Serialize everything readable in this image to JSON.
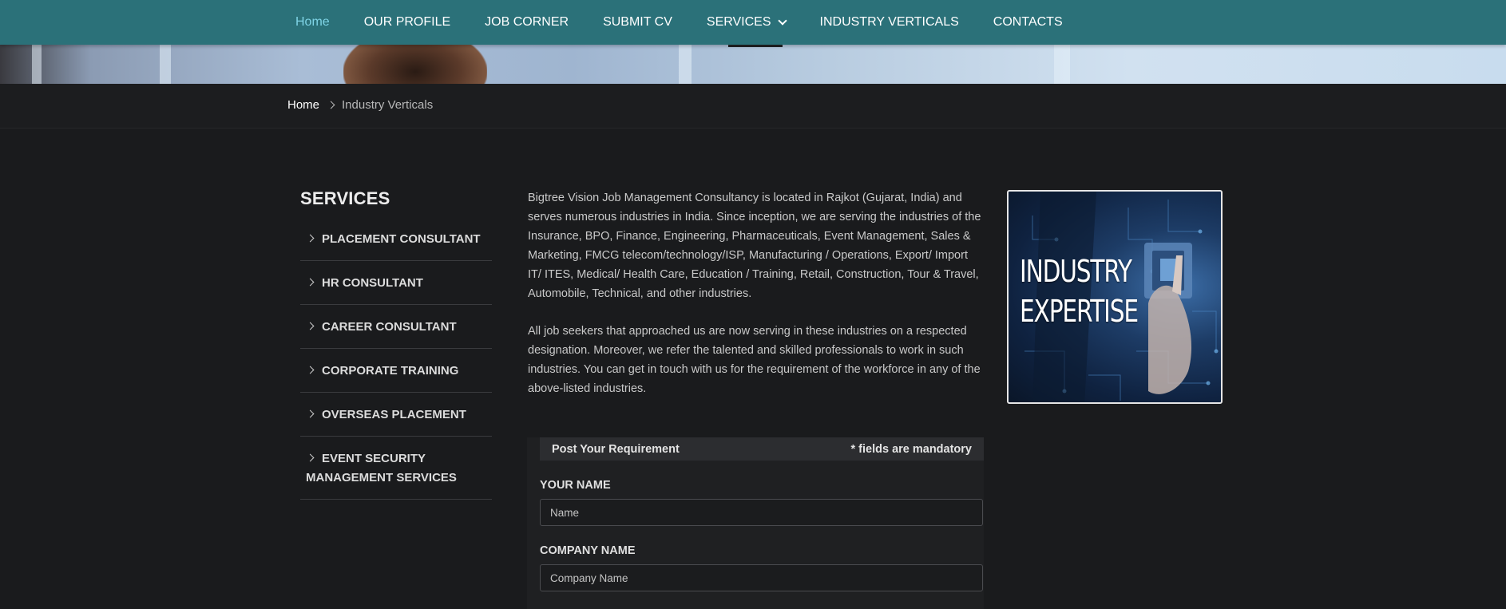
{
  "nav": {
    "items": [
      {
        "label": "Home",
        "active": true
      },
      {
        "label": "OUR PROFILE"
      },
      {
        "label": "JOB CORNER"
      },
      {
        "label": "SUBMIT CV"
      },
      {
        "label": "SERVICES",
        "dropdown": true
      },
      {
        "label": "INDUSTRY VERTICALS"
      },
      {
        "label": "CONTACTS"
      }
    ],
    "background": "#2b7179",
    "active_color": "#7fd4e6"
  },
  "breadcrumb": {
    "home": "Home",
    "current": "Industry Verticals",
    "separator_icon": "chevron-right-icon"
  },
  "sidebar": {
    "title": "SERVICES",
    "items": [
      {
        "label": "PLACEMENT CONSULTANT"
      },
      {
        "label": "HR CONSULTANT"
      },
      {
        "label": "CAREER CONSULTANT"
      },
      {
        "label": "CORPORATE TRAINING"
      },
      {
        "label": "OVERSEAS PLACEMENT"
      },
      {
        "label": "EVENT SECURITY MANAGEMENT SERVICES"
      }
    ]
  },
  "content": {
    "paragraph1": "Bigtree Vision Job Management Consultancy is located in Rajkot (Gujarat, India) and serves numerous industries in India. Since inception, we are serving the industries of the Insurance, BPO, Finance, Engineering, Pharmaceuticals, Event Management, Sales & Marketing, FMCG telecom/technology/ISP, Manufacturing / Operations, Export/ Import IT/ ITES, Medical/ Health Care, Education / Training, Retail, Construction, Tour & Travel, Automobile, Technical, and other industries.",
    "paragraph2": "All job seekers that approached us are now serving in these industries on a respected designation. Moreover, we refer the talented and skilled professionals to work in such industries. You can get in touch with us for the requirement of the workforce in any of the above-listed industries."
  },
  "feature_image": {
    "line1": "INDUSTRY",
    "line2": "EXPERTISE"
  },
  "form": {
    "title": "Post Your Requirement",
    "mandatory_note": "* fields are mandatory",
    "name_label": "YOUR NAME",
    "name_placeholder": "Name",
    "company_label": "COMPANY NAME",
    "company_placeholder": "Company Name"
  }
}
